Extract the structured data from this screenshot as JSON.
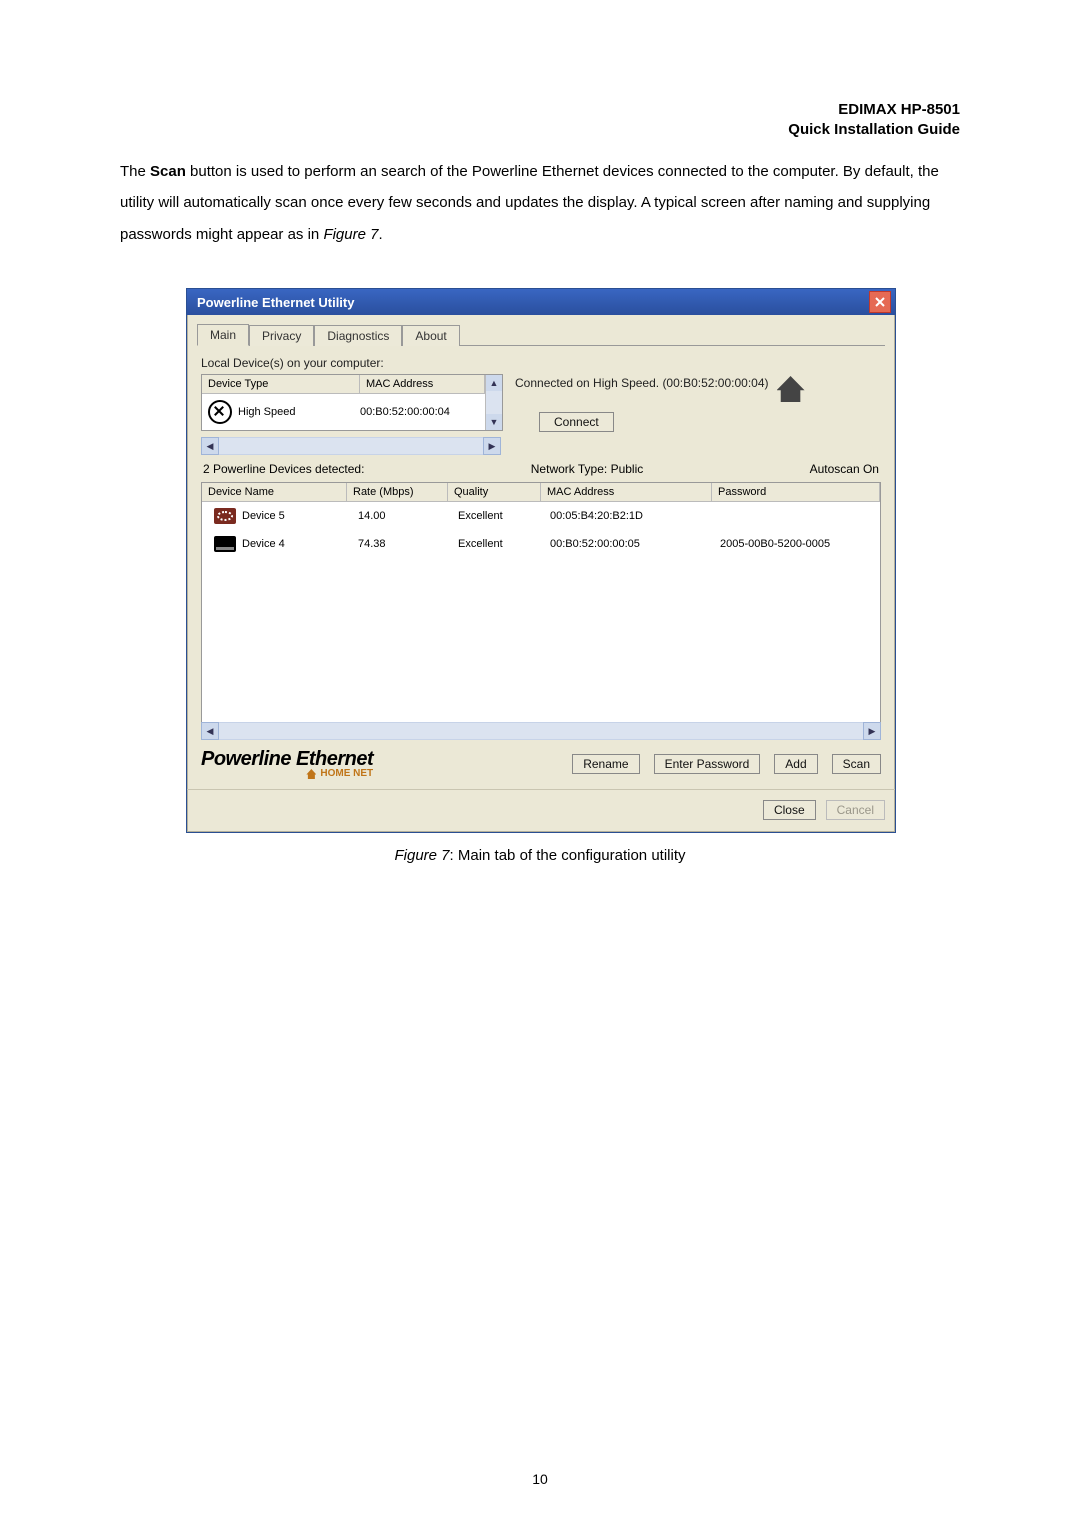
{
  "header": {
    "line1": "EDIMAX  HP-8501",
    "line2": "Quick Installation Guide"
  },
  "intro": {
    "t1": "The ",
    "scan": "Scan",
    "t2": " button is used to perform an search of the Powerline Ethernet devices connected to the computer. By default, the utility will automatically scan once every few seconds and updates the display. A typical screen after naming and supplying passwords might appear as in ",
    "figref": "Figure 7",
    "t3": "."
  },
  "win": {
    "title": "Powerline Ethernet Utility",
    "tabs": [
      "Main",
      "Privacy",
      "Diagnostics",
      "About"
    ],
    "active_tab": 0,
    "local_label": "Local Device(s) on your computer:",
    "local_headers": {
      "col1": "Device Type",
      "col2": "MAC Address"
    },
    "local_row": {
      "type": "High Speed",
      "mac": "00:B0:52:00:00:04"
    },
    "connected_text": "Connected on High Speed. (00:B0:52:00:00:04)",
    "connect_btn": "Connect",
    "status": {
      "detected": "2 Powerline Devices detected:",
      "ntype": "Network Type: Public",
      "autoscan": "Autoscan On"
    },
    "dev_headers": {
      "name": "Device Name",
      "rate": "Rate (Mbps)",
      "qual": "Quality",
      "mac": "MAC Address",
      "pass": "Password"
    },
    "devices": [
      {
        "name": "Device 5",
        "rate": "14.00",
        "qual": "Excellent",
        "mac": "00:05:B4:20:B2:1D",
        "pass": ""
      },
      {
        "name": "Device 4",
        "rate": "74.38",
        "qual": "Excellent",
        "mac": "00:B0:52:00:00:05",
        "pass": "2005-00B0-5200-0005"
      }
    ],
    "brand": {
      "line1": "Powerline Ethernet",
      "line2": "HOME NET"
    },
    "actions": {
      "rename": "Rename",
      "enterpw": "Enter Password",
      "add": "Add",
      "scan": "Scan"
    },
    "footer": {
      "close": "Close",
      "cancel": "Cancel"
    }
  },
  "caption": {
    "figref": "Figure 7",
    "rest": ": Main tab of the configuration utility"
  },
  "page_number": "10"
}
